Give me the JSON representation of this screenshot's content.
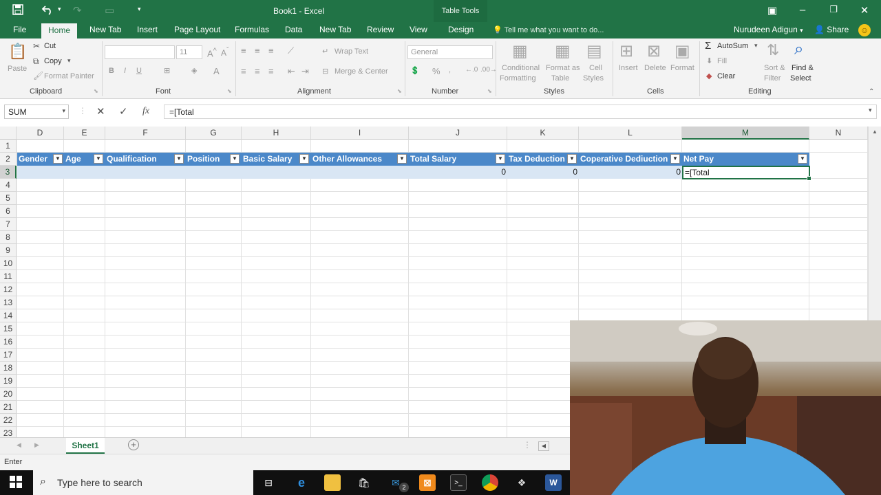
{
  "window": {
    "title": "Book1 - Excel",
    "context_tab": "Table Tools"
  },
  "ribbon_tabs": [
    "File",
    "Home",
    "New Tab",
    "Insert",
    "Page Layout",
    "Formulas",
    "Data",
    "New Tab",
    "Review",
    "View",
    "Design"
  ],
  "active_tab": "Home",
  "tell_me": "Tell me what you want to do...",
  "account_name": "Nurudeen Adigun",
  "share_label": "Share",
  "ribbon": {
    "clipboard": {
      "paste": "Paste",
      "cut": "Cut",
      "copy": "Copy",
      "format_painter": "Format Painter",
      "label": "Clipboard"
    },
    "font": {
      "size": "11",
      "label": "Font"
    },
    "alignment": {
      "wrap_text": "Wrap Text",
      "merge_center": "Merge & Center",
      "label": "Alignment"
    },
    "number": {
      "format": "General",
      "label": "Number"
    },
    "styles": {
      "conditional": [
        "Conditional",
        "Formatting"
      ],
      "format_as_table": [
        "Format as",
        "Table"
      ],
      "cell_styles": [
        "Cell",
        "Styles"
      ],
      "label": "Styles"
    },
    "cells": {
      "insert": "Insert",
      "delete": "Delete",
      "format": "Format",
      "label": "Cells"
    },
    "editing": {
      "autosum": "AutoSum",
      "fill": "Fill",
      "clear": "Clear",
      "sort_filter": [
        "Sort &",
        "Filter"
      ],
      "find_select": [
        "Find &",
        "Select"
      ],
      "label": "Editing"
    }
  },
  "formula_bar": {
    "name_box": "SUM",
    "formula": "=[Total"
  },
  "columns": [
    "D",
    "E",
    "F",
    "G",
    "H",
    "I",
    "J",
    "K",
    "L",
    "M",
    "N"
  ],
  "selected_column": "M",
  "rows": [
    "1",
    "2",
    "3",
    "4",
    "5",
    "6",
    "7",
    "8",
    "9",
    "10",
    "11",
    "12",
    "13",
    "14",
    "15",
    "16",
    "17",
    "18",
    "19",
    "20",
    "21",
    "22",
    "23"
  ],
  "selected_row": "3",
  "table": {
    "headers": [
      "Gender",
      "Age",
      "Qualification",
      "Position",
      "Basic Salary",
      "Other Allowances",
      "Total Salary",
      "Tax Deduction",
      "Coperative Dediuction",
      "Net Pay"
    ],
    "row3": {
      "total_salary": "0",
      "tax_deduction": "0",
      "coperative": "0",
      "editing": "=[Total"
    }
  },
  "sheet_tab": "Sheet1",
  "status": "Enter",
  "taskbar": {
    "search_placeholder": "Type here to search",
    "mail_badge": "2"
  }
}
